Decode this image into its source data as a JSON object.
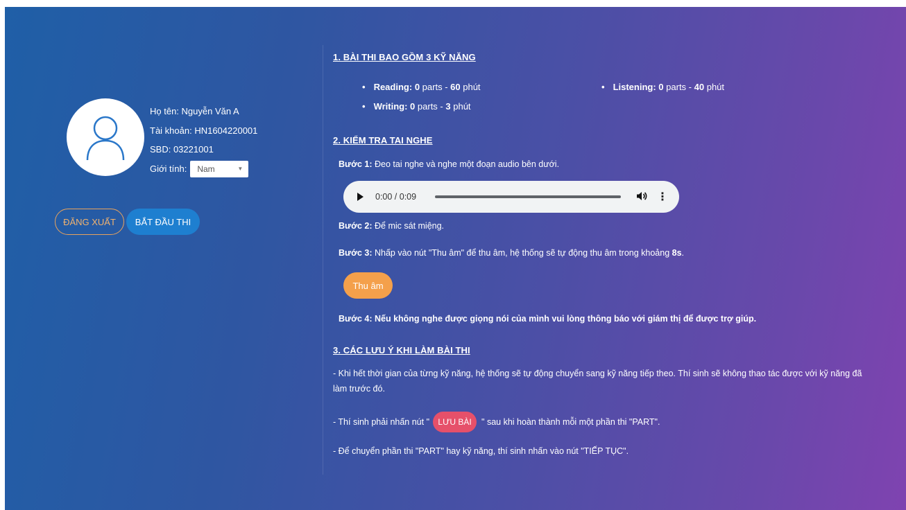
{
  "profile": {
    "name_label": "Họ tên: Nguyễn Văn A",
    "account_label": "Tài khoản: HN1604220001",
    "sbd_label": "SBD: 03221001",
    "gender_label": "Giới tính:",
    "gender_value": "Nam",
    "logout_label": "ĐĂNG XUẤT",
    "start_label": "BẮT ĐẦU THI"
  },
  "section1": {
    "heading": "1. BÀI THI BAO GỒM 3 KỸ NĂNG",
    "skills": [
      {
        "name": "Reading",
        "parts": "0",
        "parts_text": "parts",
        "minutes": "60",
        "unit": "phút"
      },
      {
        "name": "Listening",
        "parts": "0",
        "parts_text": "parts",
        "minutes": "40",
        "unit": "phút"
      },
      {
        "name": "Writing",
        "parts": "0",
        "parts_text": "parts",
        "minutes": "3",
        "unit": "phút"
      }
    ]
  },
  "section2": {
    "heading": "2. KIỂM TRA TAI NGHE",
    "step1_label": "Bước 1:",
    "step1_text": "Đeo tai nghe và nghe một đoạn audio bên dưới.",
    "audio_time": "0:00 / 0:09",
    "step2_label": "Bước 2:",
    "step2_text": "Để mic sát miệng.",
    "step3_label": "Bước 3:",
    "step3_text": "Nhấp vào nút \"Thu âm\" để thu âm, hệ thống sẽ tự động thu âm trong khoảng",
    "step3_duration": "8s",
    "record_label": "Thu âm",
    "step4_text": "Bước 4: Nếu không nghe được giọng nói của mình vui lòng thông báo với giám thị để được trợ giúp."
  },
  "section3": {
    "heading": "3. CÁC LƯU Ý KHI LÀM BÀI THI",
    "note1": "- Khi hết thời gian của từng kỹ năng, hệ thống sẽ tự động chuyển sang kỹ năng tiếp theo. Thí sinh sẽ không thao tác được với kỹ năng đã làm trước đó.",
    "note2_before": "- Thí sinh phải nhấn nút \"",
    "save_label": "LƯU BÀI",
    "note2_after": "\" sau khi hoàn thành mỗi một phần thi \"PART\".",
    "note3": "- Để chuyển phần thi \"PART\" hay kỹ năng, thí sinh nhấn vào nút \"TIẾP TỤC\"."
  },
  "colors": {
    "bg_start": "#1f5fa7",
    "bg_end": "#7f43b0",
    "logout_border": "#e9a35d",
    "start_button": "#1e7fd0",
    "record_button": "#f4a04b",
    "save_button": "#e6506a"
  },
  "icons": {
    "avatar": "user-outline-icon",
    "play": "play-icon",
    "volume": "volume-icon",
    "more": "more-vertical-icon",
    "select": "caret-down-icon"
  }
}
